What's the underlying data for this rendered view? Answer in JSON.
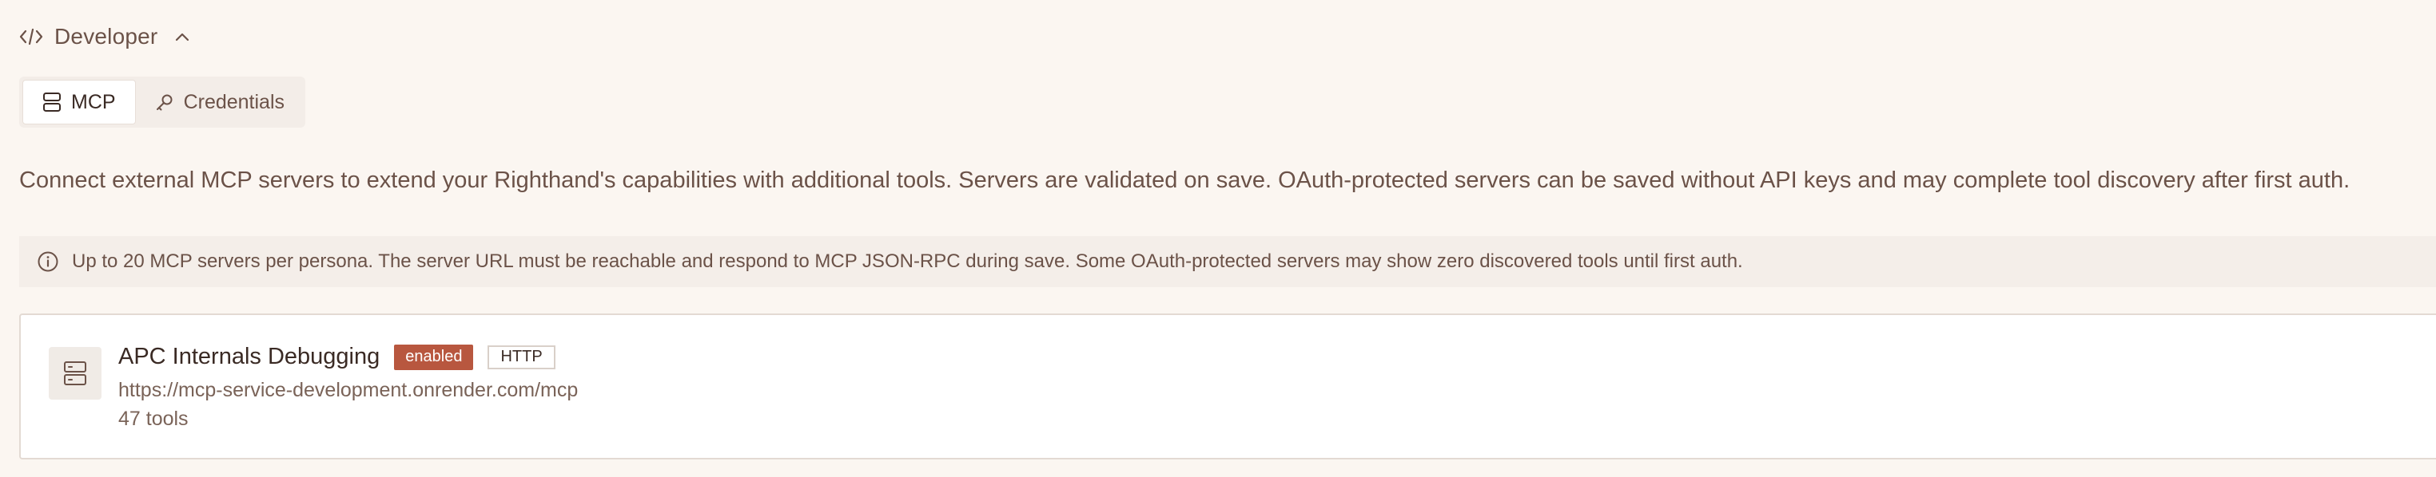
{
  "section": {
    "title": "Developer",
    "icon": "code-icon",
    "toggle_icon": "chevron-up-icon"
  },
  "tabs": [
    {
      "label": "MCP",
      "icon": "server-icon",
      "active": true
    },
    {
      "label": "Credentials",
      "icon": "key-icon",
      "active": false
    }
  ],
  "description": "Connect external MCP servers to extend your Righthand's capabilities with additional tools. Servers are validated on save. OAuth-protected servers can be saved without API keys and may complete tool discovery after first auth.",
  "info_banner": {
    "icon": "info-icon",
    "text": "Up to 20 MCP servers per persona. The server URL must be reachable and respond to MCP JSON-RPC during save. Some OAuth-protected servers may show zero discovered tools until first auth."
  },
  "servers": [
    {
      "name": "APC Internals Debugging",
      "status": "enabled",
      "transport": "HTTP",
      "url": "https://mcp-service-development.onrender.com/mcp",
      "tools": "47 tools",
      "icon": "server-icon"
    }
  ],
  "colors": {
    "background": "#fbf6f1",
    "text": "#6b5248",
    "status_enabled": "#b8573f",
    "card_border": "#e3dad3"
  }
}
